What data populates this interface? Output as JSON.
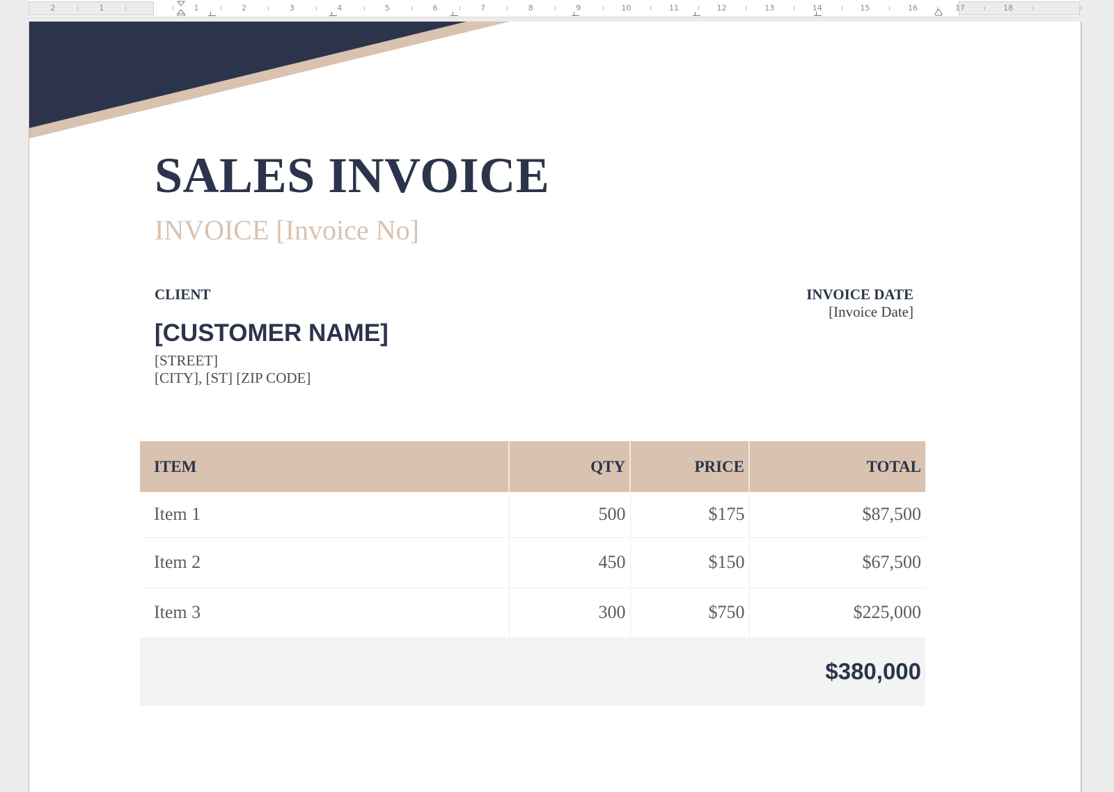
{
  "ruler": {
    "left_margin_numbers": [
      "2",
      "1"
    ],
    "numbers": [
      "1",
      "2",
      "3",
      "4",
      "5",
      "6",
      "7",
      "8",
      "9",
      "10",
      "11",
      "12",
      "13",
      "14",
      "15",
      "16"
    ],
    "right_margin_numbers": [
      "17",
      "18"
    ]
  },
  "document": {
    "title": "SALES INVOICE",
    "subtitle": "INVOICE [Invoice No]",
    "client_label": "CLIENT",
    "customer_name": "[CUSTOMER NAME]",
    "street": "[STREET]",
    "city_line": "[CITY], [ST] [ZIP CODE]",
    "invoice_date_label": "INVOICE DATE",
    "invoice_date_value": "[Invoice Date]"
  },
  "table": {
    "headers": {
      "item": "ITEM",
      "qty": "QTY",
      "price": "PRICE",
      "total": "TOTAL"
    },
    "rows": [
      {
        "item": "Item 1",
        "qty": "500",
        "price": "$175",
        "total": "$87,500"
      },
      {
        "item": "Item 2",
        "qty": "450",
        "price": "$150",
        "total": "$67,500"
      },
      {
        "item": "Item 3",
        "qty": "300",
        "price": "$750",
        "total": "$225,000"
      }
    ],
    "grand_total": "$380,000"
  },
  "colors": {
    "navy": "#2b344a",
    "tan": "#d9c2b0",
    "total_row_bg": "#f3f3f3"
  }
}
